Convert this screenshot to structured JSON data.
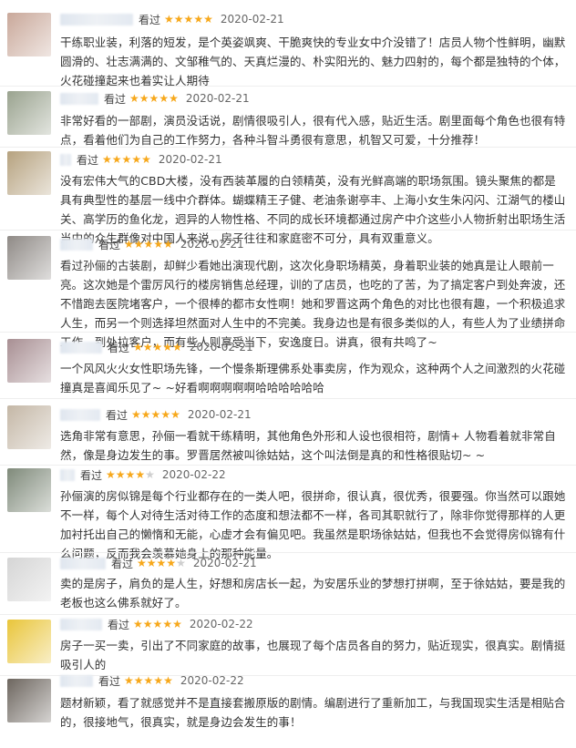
{
  "reviews": [
    {
      "avatar_color": "#c9a89a",
      "seen": "看过",
      "stars": 5,
      "date": "2020-02-21",
      "text": "干练职业装，利落的短发，是个英姿飒爽、干脆爽快的专业女中介没错了！店员人物个性鲜明，幽默圆滑的、壮志满满的、文邹稚气的、天真烂漫的、朴实阳光的、魅力四射的，每个都是独特的个体，火花碰撞起来也着实让人期待"
    },
    {
      "avatar_color": "#9aa38f",
      "seen": "看过",
      "stars": 5,
      "date": "2020-02-21",
      "text": "非常好看的一部剧，演员没话说，剧情很吸引人，很有代入感，贴近生活。剧里面每个角色也很有特点，看着他们为自己的工作努力，各种斗智斗勇很有意思，机智又可爱，十分推荐！"
    },
    {
      "avatar_color": "#b6a27f",
      "seen": "看过",
      "stars": 5,
      "date": "2020-02-21",
      "text": "没有宏伟大气的CBD大楼，没有西装革履的白领精英，没有光鲜高端的职场氛围。镜头聚焦的都是具有典型性的基层一线中介群体。蝴蝶精王子健、老油条谢亭丰、上海小女生朱闪闪、江湖气的楼山关、高学历的鱼化龙，迥异的人物性格、不同的成长环境都通过房产中介这些小人物折射出职场生活当中的众生群像对中国人来说，房子往往和家庭密不可分，具有双重意义。"
    },
    {
      "avatar_color": "#8f8a86",
      "seen": "看过",
      "stars": 5,
      "date": "2020-02-21",
      "text": "看过孙俪的古装剧，却鲜少看她出演现代剧，这次化身职场精英，身着职业装的她真是让人眼前一亮。这次她是个雷厉风行的楼房销售总经理，训的了店员，也吃的了苦，为了搞定客户到处奔波，还不惜跑去医院堵客户，一个很棒的都市女性啊！她和罗晋这两个角色的对比也很有趣，一个积极追求人生，而另一个则选择坦然面对人生中的不完美。我身边也是有很多类似的人，有些人为了业绩拼命工作，到处拉客户，而有些人则享受当下，安逸度日。讲真，很有共鸣了~"
    },
    {
      "avatar_color": "#a88f93",
      "seen": "看过",
      "stars": 5,
      "date": "2020-02-21",
      "text": "一个风风火火女性职场先锋，一个慢条斯理佛系处事卖房，作为观众，这种两个人之间激烈的火花碰撞真是喜闻乐见了~ ~好看啊啊啊啊啊哈哈哈哈哈哈"
    },
    {
      "avatar_color": "#c4b7a6",
      "seen": "看过",
      "stars": 5,
      "date": "2020-02-21",
      "text": "选角非常有意思，孙俪一看就干练精明，其他角色外形和人设也很相符，剧情+ 人物看着就非常自然，像是身边发生的事。罗晋居然被叫徐姑姑，这个叫法倒是真的和性格很贴切~ ~"
    },
    {
      "avatar_color": "#7f8a7a",
      "seen": "看过",
      "stars": 4,
      "date": "2020-02-22",
      "text": "孙俪演的房似锦是每个行业都存在的一类人吧，很拼命，很认真，很优秀，很要强。你当然可以跟她不一样，每个人对待生活对待工作的态度和想法都不一样，各司其职就行了，除非你觉得那样的人更加衬托出自己的懒惰和无能，心虚才会有偏见吧。我虽然是职场徐姑姑，但我也不会觉得房似锦有什么问题，反而我会羡慕她身上的那种能量。"
    },
    {
      "avatar_color": "#d5d5d5",
      "seen": "看过",
      "stars": 4,
      "date": "2020-02-21",
      "text": "卖的是房子，肩负的是人生，好想和房店长一起，为安居乐业的梦想打拼啊，至于徐姑姑，要是我的老板也这么佛系就好了。"
    },
    {
      "avatar_color": "#e9c53a",
      "seen": "看过",
      "stars": 5,
      "date": "2020-02-22",
      "text": "房子一买一卖，引出了不同家庭的故事，也展现了每个店员各自的努力，贴近现实，很真实。剧情挺吸引人的"
    },
    {
      "avatar_color": "#6d665f",
      "seen": "看过",
      "stars": 5,
      "date": "2020-02-22",
      "text": "题材新颖，看了就感觉并不是直接套搬原版的剧情。编剧进行了重新加工，与我国现实生活是相贴合的，很接地气，很真实，就是身边会发生的事！"
    }
  ]
}
